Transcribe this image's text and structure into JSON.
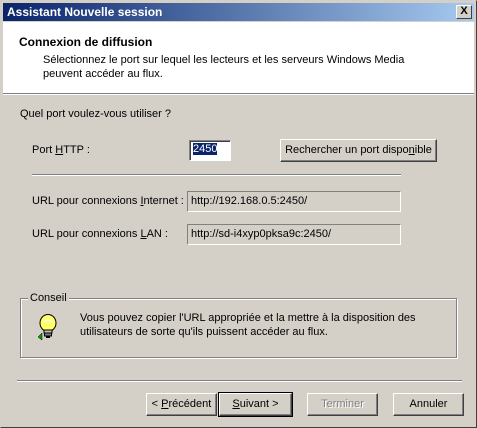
{
  "window": {
    "title": "Assistant Nouvelle session",
    "close_label": "X"
  },
  "header": {
    "title": "Connexion de diffusion",
    "description": "Sélectionnez le port sur lequel les lecteurs et les serveurs Windows Media peuvent accéder au flux."
  },
  "port": {
    "question": "Quel port voulez-vous utiliser ?",
    "http_label_pre": "Port ",
    "http_label_ul": "H",
    "http_label_post": "TTP :",
    "http_value": "2450",
    "find_button": {
      "pre": "Rechercher un port dispo",
      "ul": "n",
      "post": "ible"
    }
  },
  "urls": {
    "internet_label_pre": "URL pour connexions ",
    "internet_label_ul": "I",
    "internet_label_post": "nternet :",
    "internet_value": "http://192.168.0.5:2450/",
    "lan_label_pre": "URL pour connexions ",
    "lan_label_ul": "L",
    "lan_label_post": "AN :",
    "lan_value": "http://sd-i4xyp0pksa9c:2450/"
  },
  "tip": {
    "group_label": "Conseil",
    "text": "Vous pouvez copier l'URL appropriée et la mettre à la disposition des utilisateurs de sorte qu'ils puissent accéder au flux.",
    "icon": "lightbulb-icon"
  },
  "buttons": {
    "back": {
      "pre": "< ",
      "ul": "P",
      "post": "récédent"
    },
    "next": {
      "pre": "",
      "ul": "S",
      "post": "uivant >"
    },
    "finish": "Terminer",
    "cancel": "Annuler"
  }
}
